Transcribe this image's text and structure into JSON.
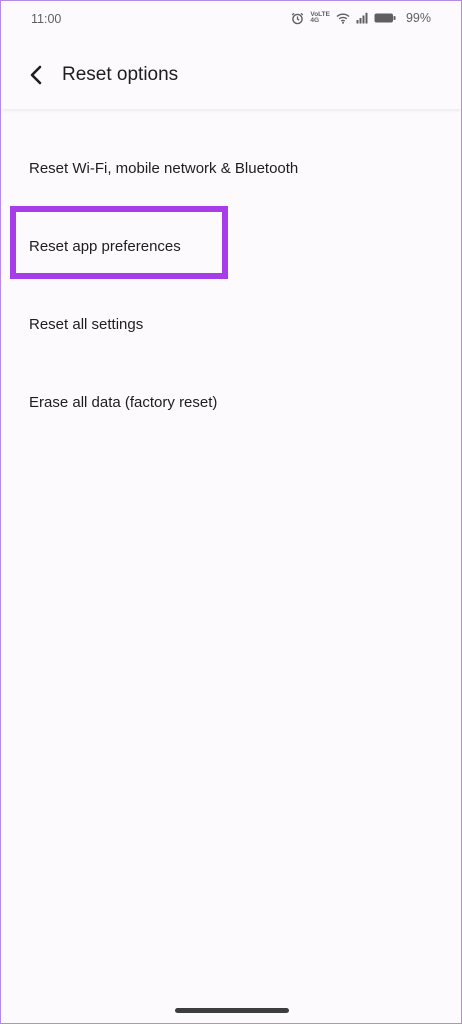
{
  "status_bar": {
    "time": "11:00",
    "network_label_top": "VoLTE",
    "network_label_bottom": "4G",
    "battery_percent": "99%",
    "icons": [
      "alarm-icon",
      "volte-icon",
      "wifi-icon",
      "signal-icon",
      "battery-icon"
    ]
  },
  "app_bar": {
    "title": "Reset options",
    "back_icon": "chevron-left-icon"
  },
  "options": [
    {
      "label": "Reset Wi-Fi, mobile network & Bluetooth"
    },
    {
      "label": "Reset app preferences"
    },
    {
      "label": "Reset all settings"
    },
    {
      "label": "Erase all data (factory reset)"
    }
  ],
  "highlight": {
    "target": "Reset app preferences",
    "color": "#a63de8"
  },
  "colors": {
    "background": "#fcfafd",
    "text": "#1e1e22",
    "status_text": "#5f5f63",
    "frame_border": "#b58ae0"
  }
}
